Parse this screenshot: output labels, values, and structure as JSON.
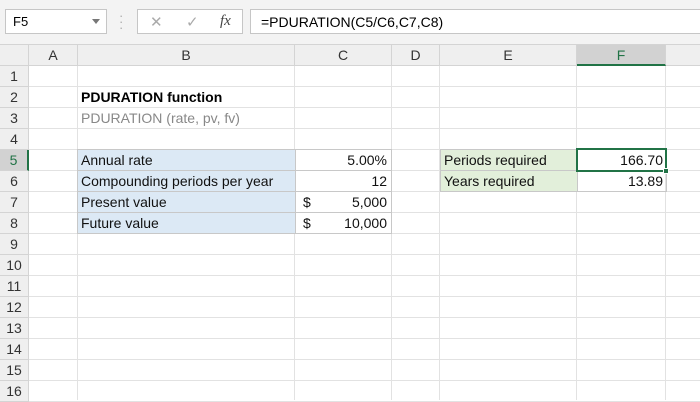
{
  "name_box": "F5",
  "formula_bar": {
    "cancel": "✕",
    "enter": "✓",
    "fx": "fx",
    "formula": "=PDURATION(C5/C6,C7,C8)"
  },
  "columns": [
    "A",
    "B",
    "C",
    "D",
    "E",
    "F"
  ],
  "rows": [
    "1",
    "2",
    "3",
    "4",
    "5",
    "6",
    "7",
    "8",
    "9",
    "10",
    "11",
    "12",
    "13",
    "14",
    "15",
    "16"
  ],
  "title": "PDURATION function",
  "subtitle": "PDURATION (rate, pv, fv)",
  "inputs": [
    {
      "label": "Annual rate",
      "currency": "",
      "value": "5.00%"
    },
    {
      "label": "Compounding periods per year",
      "currency": "",
      "value": "12"
    },
    {
      "label": "Present value",
      "currency": "$",
      "value": "5,000"
    },
    {
      "label": "Future value",
      "currency": "$",
      "value": "10,000"
    }
  ],
  "outputs": [
    {
      "label": "Periods required",
      "value": "166.70"
    },
    {
      "label": "Years required",
      "value": "13.89"
    }
  ]
}
